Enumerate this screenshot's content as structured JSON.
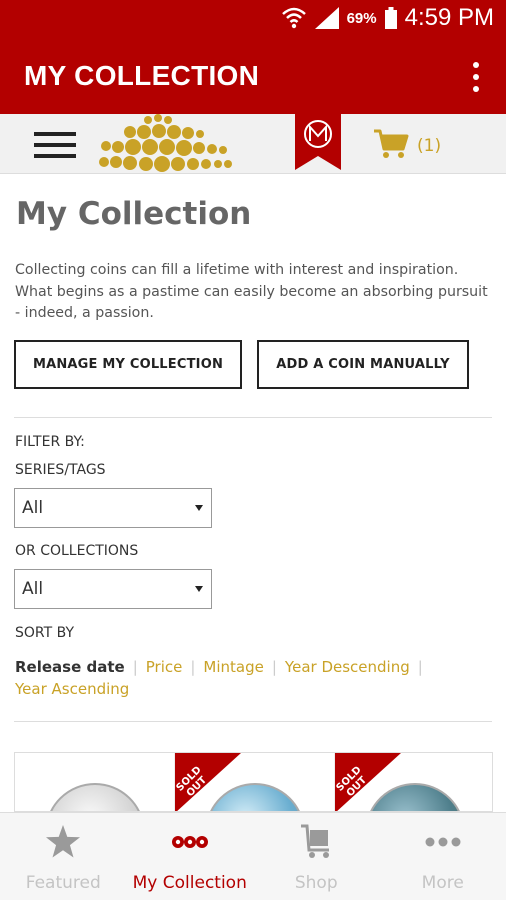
{
  "status_bar": {
    "battery": "69%",
    "time": "4:59 PM"
  },
  "app_bar": {
    "title": "MY COLLECTION"
  },
  "header": {
    "cart_count": "(1)"
  },
  "page": {
    "title": "My Collection",
    "intro": "Collecting coins can fill a lifetime with interest and inspiration. What begins as a pastime can easily become an absorbing pursuit - indeed, a passion.",
    "manage_button": "MANAGE MY COLLECTION",
    "add_button": "ADD A COIN MANUALLY"
  },
  "filters": {
    "filter_by_label": "FILTER BY:",
    "series_label": "SERIES/TAGS",
    "series_value": "All",
    "collections_label": "OR COLLECTIONS",
    "collections_value": "All"
  },
  "sort": {
    "label": "SORT BY",
    "options": [
      "Release date",
      "Price",
      "Mintage",
      "Year Descending",
      "Year Ascending"
    ],
    "active": "Release date"
  },
  "cards": {
    "badge": "SOLD OUT"
  },
  "bottom_nav": {
    "items": [
      {
        "label": "Featured",
        "icon": "star-icon"
      },
      {
        "label": "My Collection",
        "icon": "collection-icon"
      },
      {
        "label": "Shop",
        "icon": "cart-icon"
      },
      {
        "label": "More",
        "icon": "more-icon"
      }
    ],
    "active": "My Collection"
  },
  "colors": {
    "brand_red": "#b30000",
    "gold": "#c9a227"
  }
}
